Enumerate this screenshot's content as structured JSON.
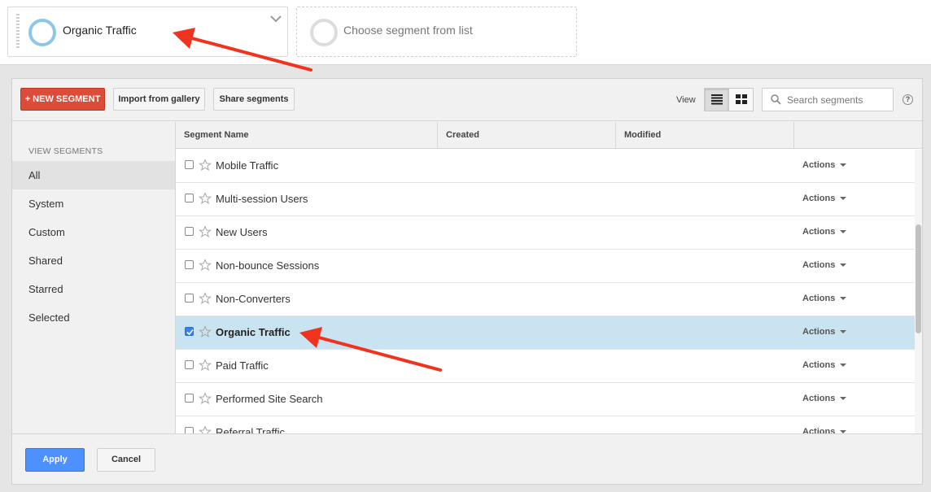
{
  "segment_bar": {
    "active_segment": "Organic Traffic",
    "empty_slot": "Choose segment from list"
  },
  "toolbar": {
    "new_segment_label": "+ NEW SEGMENT",
    "import_label": "Import from gallery",
    "share_label": "Share segments",
    "view_label": "View",
    "search_placeholder": "Search segments",
    "help_label": "?"
  },
  "sidenav": {
    "heading": "VIEW SEGMENTS",
    "items": [
      {
        "label": "All",
        "active": true
      },
      {
        "label": "System"
      },
      {
        "label": "Custom"
      },
      {
        "label": "Shared"
      },
      {
        "label": "Starred"
      },
      {
        "label": "Selected"
      }
    ]
  },
  "table": {
    "columns": [
      "Segment Name",
      "Created",
      "Modified"
    ],
    "actions_label": "Actions",
    "rows": [
      {
        "name": "Mobile Traffic",
        "checked": false
      },
      {
        "name": "Multi-session Users",
        "checked": false
      },
      {
        "name": "New Users",
        "checked": false
      },
      {
        "name": "Non-bounce Sessions",
        "checked": false
      },
      {
        "name": "Non-Converters",
        "checked": false
      },
      {
        "name": "Organic Traffic",
        "checked": true
      },
      {
        "name": "Paid Traffic",
        "checked": false
      },
      {
        "name": "Performed Site Search",
        "checked": false
      },
      {
        "name": "Referral Traffic",
        "checked": false
      }
    ]
  },
  "footer": {
    "apply_label": "Apply",
    "cancel_label": "Cancel"
  },
  "colors": {
    "accent_red": "#dd4b39",
    "apply_blue": "#4d90fe",
    "selected_row": "#c9e3f1",
    "arrow_red": "#f0321e"
  }
}
